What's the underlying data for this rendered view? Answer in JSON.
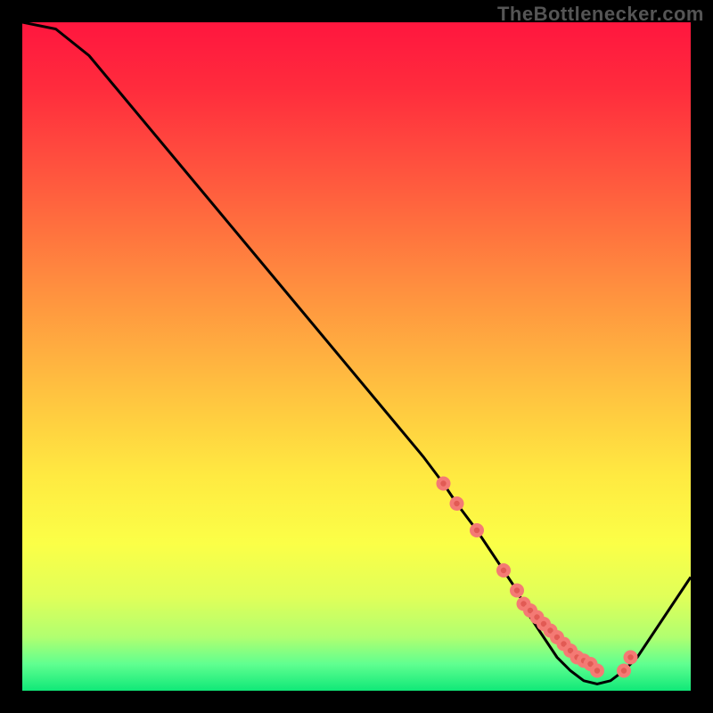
{
  "attribution": "TheBottlenecker.com",
  "chart_data": {
    "type": "line",
    "title": "",
    "xlabel": "",
    "ylabel": "",
    "x": [
      0,
      5,
      10,
      15,
      20,
      25,
      30,
      35,
      40,
      45,
      50,
      55,
      60,
      63,
      65,
      68,
      70,
      72,
      74,
      76,
      78,
      80,
      82,
      84,
      86,
      88,
      90,
      92,
      94,
      96,
      98,
      100
    ],
    "values": [
      102,
      99,
      95,
      89,
      83,
      77,
      71,
      65,
      59,
      53,
      47,
      41,
      35,
      31,
      28,
      24,
      21,
      18,
      15,
      11,
      8,
      5,
      3,
      1.5,
      1,
      1.5,
      3,
      5,
      8,
      11,
      14,
      17
    ],
    "xlim": [
      0,
      100
    ],
    "ylim": [
      0,
      100
    ],
    "markers": {
      "x": [
        63,
        65,
        68,
        72,
        74,
        75,
        76,
        77,
        78,
        79,
        80,
        81,
        82,
        83,
        84,
        85,
        86,
        90,
        91
      ],
      "y": [
        31,
        28,
        24,
        18,
        15,
        13,
        12,
        11,
        10,
        9,
        8,
        7,
        6,
        5,
        4.5,
        4,
        3,
        3,
        5
      ]
    },
    "gradient_stops": [
      {
        "offset": 0.0,
        "color": "#ff163e"
      },
      {
        "offset": 0.1,
        "color": "#ff2c3d"
      },
      {
        "offset": 0.25,
        "color": "#ff5d3e"
      },
      {
        "offset": 0.4,
        "color": "#ff903f"
      },
      {
        "offset": 0.55,
        "color": "#ffc140"
      },
      {
        "offset": 0.68,
        "color": "#ffea41"
      },
      {
        "offset": 0.78,
        "color": "#fbff47"
      },
      {
        "offset": 0.86,
        "color": "#e0ff59"
      },
      {
        "offset": 0.92,
        "color": "#b0ff70"
      },
      {
        "offset": 0.96,
        "color": "#60ff90"
      },
      {
        "offset": 1.0,
        "color": "#10e878"
      }
    ],
    "marker_color": "#f47a74",
    "marker_dark_color": "#e25a54",
    "line_color": "#000000"
  }
}
